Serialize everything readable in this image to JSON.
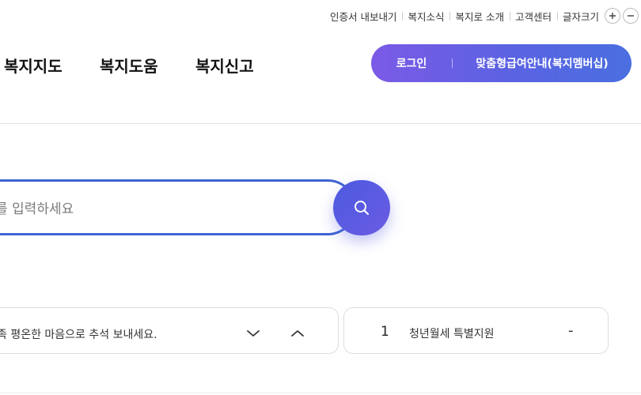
{
  "utility": {
    "links": [
      "인증서 내보내기",
      "복지소식",
      "복지로 소개",
      "고객센터"
    ],
    "font_size_label": "글자크기"
  },
  "nav": {
    "items": [
      "복지지도",
      "복지도움",
      "복지신고"
    ]
  },
  "auth": {
    "login_label": "로그인",
    "member_label": "맞춤형급여안내(복지멤버십)"
  },
  "search": {
    "placeholder": "를 입력하세요"
  },
  "notice": {
    "text": "족 평온한 마음으로 추석 보내세요."
  },
  "ranking": {
    "rank": "1",
    "title": "청년월세 특별지원",
    "change": "-"
  },
  "colors": {
    "accent_start": "#7b5ae6",
    "accent_end": "#4a6fe0",
    "search_border": "#3f63d2"
  },
  "icons": [
    "search-icon",
    "plus-icon",
    "minus-icon",
    "chevron-down-icon",
    "chevron-up-icon"
  ]
}
